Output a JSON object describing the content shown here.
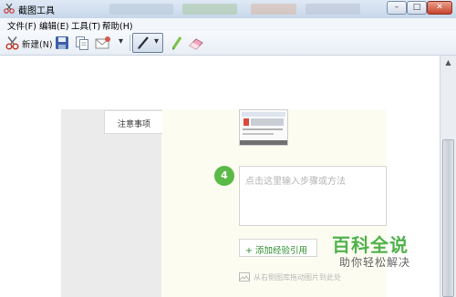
{
  "window": {
    "title": "截图工具",
    "buttons": {
      "minimize": "–",
      "maximize": "□",
      "close": "✕"
    }
  },
  "menu": [
    {
      "label": "文件(F)"
    },
    {
      "label": "编辑(E)"
    },
    {
      "label": "工具(T)"
    },
    {
      "label": "帮助(H)"
    }
  ],
  "toolbar": {
    "new_label": "新建(N)",
    "dropdown_arrow": "▾",
    "icons": [
      "scissors-icon",
      "save-icon",
      "copy-icon",
      "email-icon",
      "pen-icon",
      "highlighter-icon",
      "eraser-icon"
    ]
  },
  "page": {
    "notice_tab_label": "注意事项",
    "step": {
      "number": "4",
      "placeholder": "点击这里输入步骤或方法"
    },
    "add_quote_label": "+ 添加经验引用",
    "drag_hint": "从右侧图库拖动图片到此处"
  },
  "watermark": {
    "title": "百科全说",
    "subtitle": "助你轻松解决"
  },
  "colors": {
    "accent_green": "#5bb947",
    "cream_panel": "#fcfcf0",
    "gray_panel": "#ebebeb"
  }
}
